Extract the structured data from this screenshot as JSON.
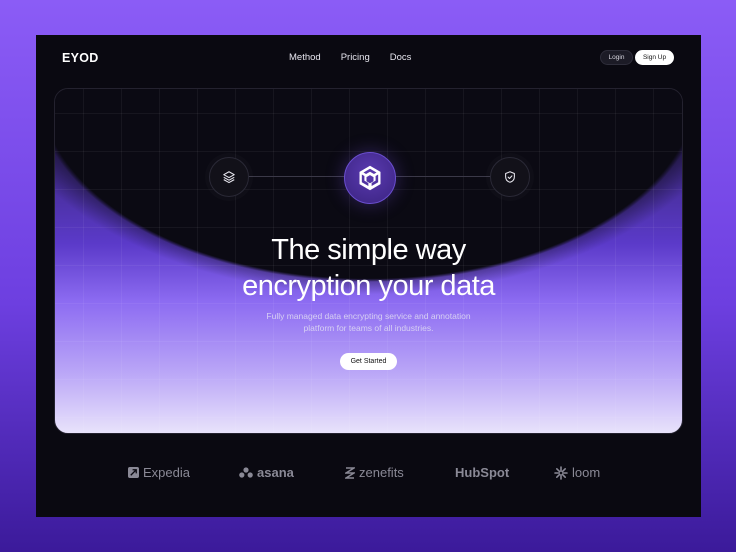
{
  "nav": {
    "logo": "EYOD",
    "links": [
      "Method",
      "Pricing",
      "Docs"
    ],
    "login_label": "Login",
    "signup_label": "Sign Up"
  },
  "hero": {
    "headline_line1": "The simple way",
    "headline_line2": "encryption your data",
    "subtitle_line1": "Fully managed data encrypting service and annotation",
    "subtitle_line2": "platform for teams of all industries.",
    "cta_label": "Get Started",
    "icons": [
      "layers-icon",
      "unity-cube-icon",
      "shield-check-icon"
    ]
  },
  "partners": [
    "Expedia",
    "asana",
    "zenefits",
    "HubSpot",
    "loom"
  ],
  "colors": {
    "accent": "#8b5cf6",
    "frame_bg": "#0a0911",
    "text": "#ffffff",
    "logo_gray": "#8a8996"
  }
}
